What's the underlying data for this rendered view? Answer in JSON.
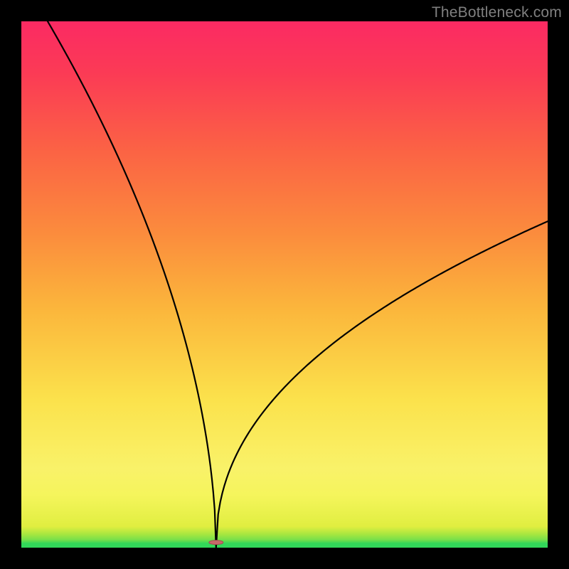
{
  "watermark": "TheBottleneck.com",
  "chart_data": {
    "type": "line",
    "title": "",
    "xlabel": "",
    "ylabel": "",
    "xlim": [
      0,
      100
    ],
    "ylim": [
      0,
      100
    ],
    "curve_min_x": 37,
    "left_start": {
      "x": 5,
      "y": 100
    },
    "right_end": {
      "x": 100,
      "y": 62
    },
    "marker": {
      "x": 37,
      "y": 1,
      "color": "#c66a6a",
      "rx": 10,
      "ry": 3
    },
    "background_gradient": [
      {
        "stop": 0,
        "color": "#fb2a63"
      },
      {
        "stop": 50,
        "color": "#fbd645"
      },
      {
        "stop": 95,
        "color": "#f5f55c"
      },
      {
        "stop": 100,
        "color": "#32d85a"
      }
    ],
    "frame_color": "#000000"
  }
}
